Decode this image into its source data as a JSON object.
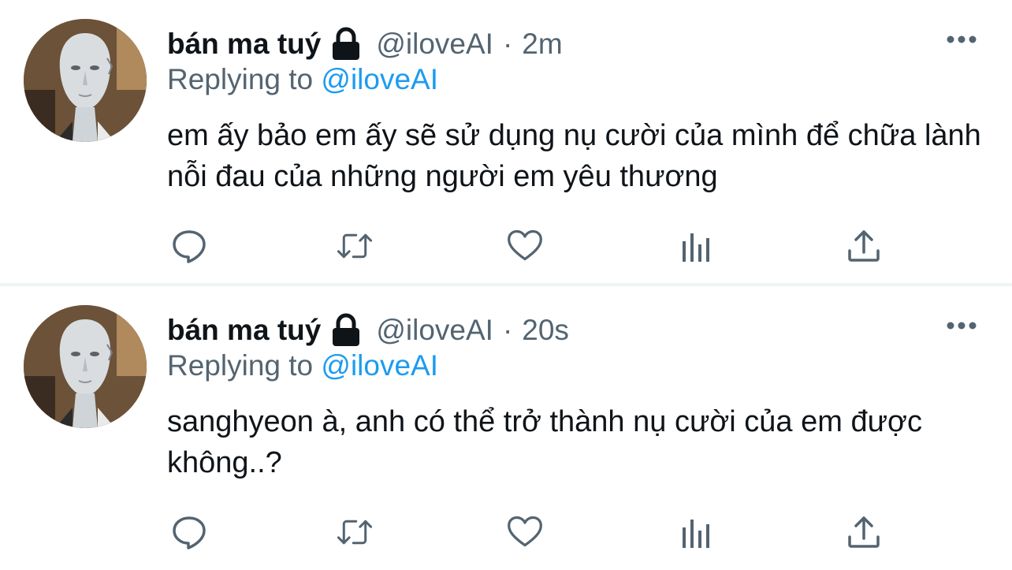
{
  "tweets": [
    {
      "display_name": "bán ma tuý",
      "handle": "@iloveAI",
      "separator": "·",
      "time": "2m",
      "replying_prefix": "Replying to",
      "replying_to": "@iloveAI",
      "text": "em ấy bảo em ấy sẽ sử dụng nụ cười của mình để chữa lành nỗi đau của những người em yêu thương",
      "locked": true
    },
    {
      "display_name": "bán ma tuý",
      "handle": "@iloveAI",
      "separator": "·",
      "time": "20s",
      "replying_prefix": "Replying to",
      "replying_to": "@iloveAI",
      "text": "sanghyeon à, anh có thể trở thành nụ cười của em được không..?",
      "locked": true
    }
  ],
  "icons": {
    "lock": "lock-icon",
    "more": "more-icon",
    "reply": "reply-icon",
    "retweet": "retweet-icon",
    "like": "heart-icon",
    "views": "views-icon",
    "share": "share-icon"
  },
  "colors": {
    "text": "#0f1419",
    "secondary": "#536471",
    "mention": "#1d9bf0",
    "divider": "#eff3f4"
  }
}
